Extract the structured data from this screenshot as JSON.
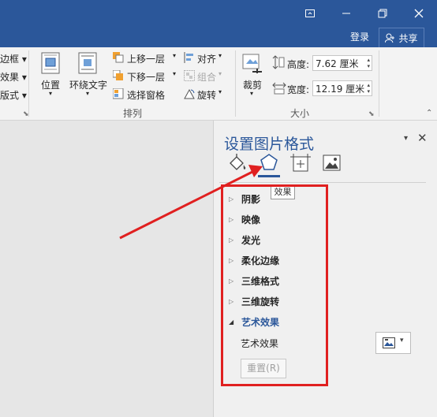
{
  "window_controls": {
    "ribbon_display_icon": "ribbon-display-icon",
    "minimize_icon": "minimize-icon",
    "restore_icon": "restore-icon",
    "close_icon": "close-icon"
  },
  "account": {
    "login": "登录",
    "share": "共享"
  },
  "ribbon": {
    "left_partial": [
      "边框",
      "效果",
      "版式"
    ],
    "position": "位置",
    "wrap_text": "环绕文字",
    "bring_forward": "上移一层",
    "send_backward": "下移一层",
    "selection_pane": "选择窗格",
    "align": "对齐",
    "group": "组合",
    "rotate": "旋转",
    "arrange_label": "排列",
    "crop": "裁剪",
    "height_label": "高度:",
    "height_value": "7.62 厘米",
    "width_label": "宽度:",
    "width_value": "12.19 厘米",
    "size_label": "大小"
  },
  "pane": {
    "title": "设置图片格式",
    "tooltip": "效果",
    "sections": [
      "阴影",
      "映像",
      "发光",
      "柔化边缘",
      "三维格式",
      "三维旋转"
    ],
    "active_section": "艺术效果",
    "sub_item": "艺术效果",
    "reset": "重置(R)"
  },
  "colors": {
    "title_bar": "#2b579a",
    "highlight": "#e02020",
    "accent": "#2b579a"
  }
}
